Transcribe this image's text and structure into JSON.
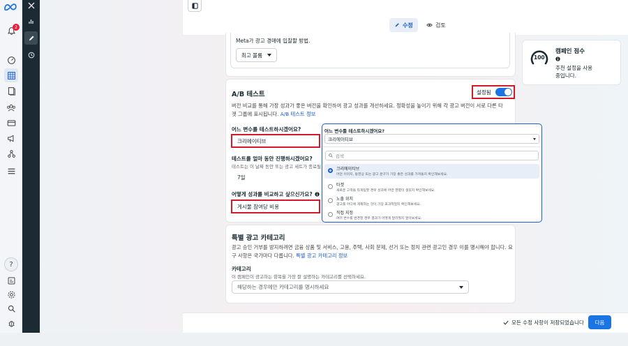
{
  "nav": {
    "notification_count": "2"
  },
  "tabs": {
    "edit": "수정",
    "review": "검토"
  },
  "auction": {
    "description": "Meta가 광고 경매에 입찰할 방법.",
    "bid_strategy": "최고 볼륨"
  },
  "ab_test": {
    "title": "A/B 테스트",
    "toggle_label": "설정됨",
    "description_line1": "버전 비교를 통해 가장 성과가 좋은 버전을 확인하여 광고 성과를 개선하세요. 정확성을 높이기 위해 각 광고 버전이 서로 다른 타",
    "description_line2": "겟 그룹에 표시됩니다.",
    "info_link": "A/B 테스트 정보",
    "variable_question": "어느 변수를 테스트하시겠어요?",
    "variable_value": "크리에이티브",
    "duration_question": "테스트를 얼마 동안 진행하시겠어요?",
    "duration_note": "테스트는 이 날짜 동안 또는 광고 세트가 종료될 때",
    "duration_value": "7일",
    "compare_question": "어떻게 성과를 비교하고 싶으신가요?",
    "compare_value": "게시물 참여당 비용"
  },
  "popover": {
    "title": "어느 변수를 테스트하시겠어요?",
    "selected": "크리에이티브",
    "search_placeholder": "검색",
    "options": [
      {
        "title": "크리에이티브",
        "desc": "어떤 이미지, 동영상 또는 광고 문구가 가장 좋은 성과를 가져올지 확인해보세요."
      },
      {
        "title": "타겟",
        "desc": "새로운 고객을 타게팅할 경우 성과에 어떤 영향이 생길지 확인해보세요."
      },
      {
        "title": "노출 위치",
        "desc": "광고를 어디에 게재하는 것이 가장 효과적일지 확인해보세요."
      },
      {
        "title": "직접 지정",
        "desc": "여러 변수를 변경할 경우 결과가 어떻게 달라질지 알아보세요."
      }
    ]
  },
  "special": {
    "title": "특별 광고 카테고리",
    "description_line1": "광고 승인 거부를 방지하려면 금융 상품 및 서비스, 고용, 주택, 사회 문제, 선거 또는 정치 관련 광고인 경우 이를 명시해야 합니다. 요",
    "description_line2": "구 사항은 국가마다 다릅니다.",
    "info_link": "특별 광고 카테고리 정보",
    "category_label": "카테고리",
    "category_note": "이 캠페인이 광고하는 항목을 가장 잘 설명하는 카테고리를 선택하세요.",
    "category_placeholder": "해당하는 경우에만 카테고리를 명시하세요"
  },
  "score": {
    "value": "100",
    "title": "캠페인 점수",
    "note_line1": "추천 설정을 사용",
    "note_line2": "중입니다."
  },
  "footer": {
    "saved_text": "모든 수정 사항이 저장되었습니다",
    "next_label": "다음"
  },
  "colors": {
    "accent": "#1b74e4",
    "highlight": "#d3192a",
    "dark_panel": "#1c2b33"
  }
}
